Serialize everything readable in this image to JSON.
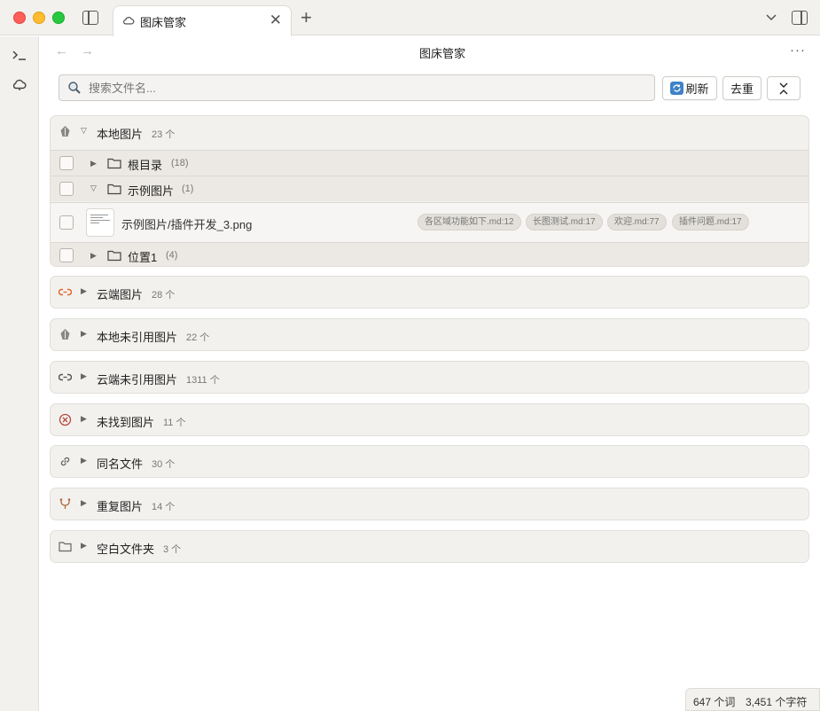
{
  "window": {
    "tab_title": "图床管家",
    "new_tab": "+",
    "close": "✕"
  },
  "view": {
    "title": "图床管家",
    "back": "←",
    "forward": "→",
    "more": "···"
  },
  "search": {
    "placeholder": "搜索文件名..."
  },
  "toolbar": {
    "refresh_label": "刷新",
    "dedupe_label": "去重",
    "collapse_label": "⌃⌄"
  },
  "groups": [
    {
      "label": "本地图片",
      "count": "23 个",
      "icon": "local-icon",
      "expanded": true
    },
    {
      "label": "云端图片",
      "count": "28 个",
      "icon": "cloud-link-icon",
      "expanded": false
    },
    {
      "label": "本地未引用图片",
      "count": "22 个",
      "icon": "local-icon",
      "expanded": false
    },
    {
      "label": "云端未引用图片",
      "count": "1311 个",
      "icon": "cloud-link-icon",
      "expanded": false
    },
    {
      "label": "未找到图片",
      "count": "11 个",
      "icon": "error-circle-icon",
      "expanded": false
    },
    {
      "label": "同名文件",
      "count": "30 个",
      "icon": "link-icon",
      "expanded": false
    },
    {
      "label": "重复图片",
      "count": "14 个",
      "icon": "merge-icon",
      "expanded": false
    },
    {
      "label": "空白文件夹",
      "count": "3 个",
      "icon": "folder-icon",
      "expanded": false
    }
  ],
  "local_tree": {
    "folders": [
      {
        "label": "根目录",
        "count": "(18)",
        "expanded": false
      },
      {
        "label": "示例图片",
        "count": "(1)",
        "expanded": true
      },
      {
        "label": "位置1",
        "count": "(4)",
        "expanded": false
      }
    ],
    "file": {
      "name": "示例图片/插件开发_3.png",
      "refs": [
        "各区域功能如下.md:12",
        "长图测试.md:17",
        "欢迎.md:77",
        "插件问题.md:17"
      ]
    }
  },
  "status": {
    "words": "647 个词",
    "chars": "3,451 个字符"
  }
}
